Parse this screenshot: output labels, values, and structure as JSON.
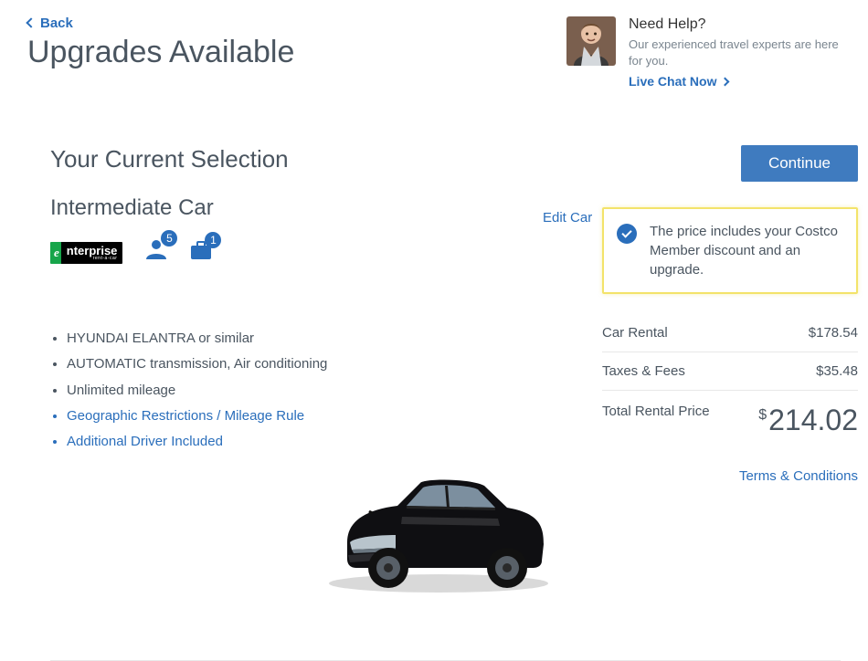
{
  "nav": {
    "back_label": "Back"
  },
  "header": {
    "title": "Upgrades Available"
  },
  "help": {
    "title": "Need Help?",
    "text": "Our experienced travel experts are here for you.",
    "cta": "Live Chat Now"
  },
  "selection": {
    "heading": "Your Current Selection",
    "car_class": "Intermediate Car",
    "vendor": "enterprise",
    "passengers": "5",
    "luggage": "1",
    "features": {
      "plain": [
        "HYUNDAI ELANTRA or similar",
        "AUTOMATIC transmission, Air conditioning",
        "Unlimited mileage"
      ],
      "links": [
        "Geographic Restrictions / Mileage Rule",
        "Additional Driver Included"
      ]
    }
  },
  "sidebar": {
    "continue": "Continue",
    "edit": "Edit Car",
    "callout": "The price includes your Costco Member discount and an upgrade.",
    "lines": {
      "rental_label": "Car Rental",
      "rental_value": "$178.54",
      "taxes_label": "Taxes & Fees",
      "taxes_value": "$35.48"
    },
    "total_label": "Total Rental Price",
    "total_currency": "$",
    "total_value": "214.02",
    "terms": "Terms & Conditions"
  }
}
